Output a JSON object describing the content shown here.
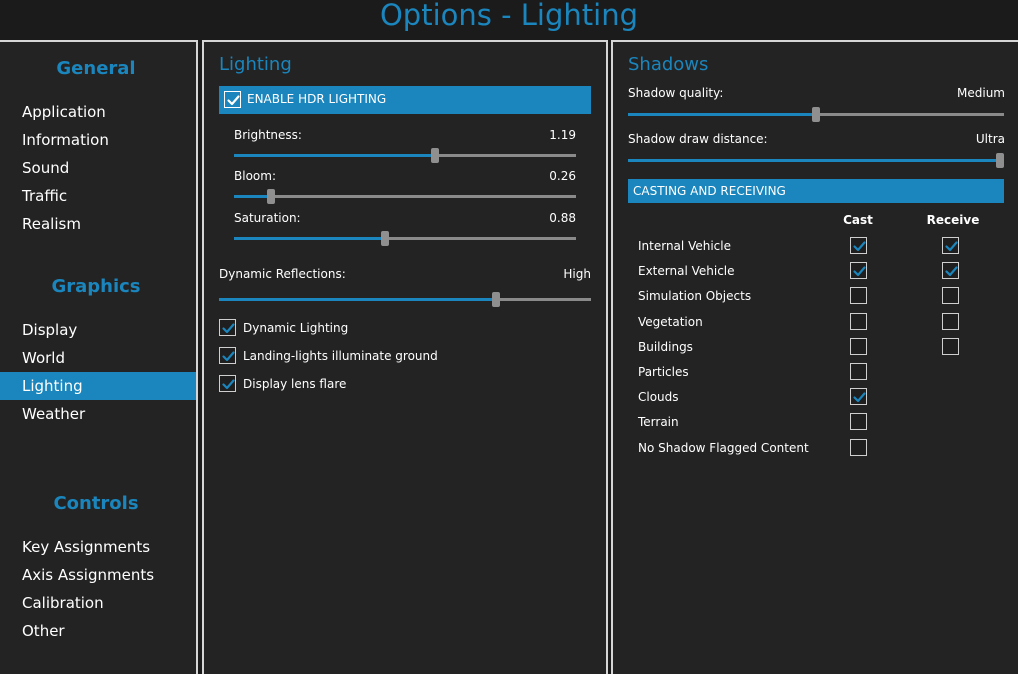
{
  "title": "Options - Lighting",
  "sidebar": {
    "sections": [
      {
        "heading": "General",
        "items": [
          "Application",
          "Information",
          "Sound",
          "Traffic",
          "Realism"
        ]
      },
      {
        "heading": "Graphics",
        "items": [
          "Display",
          "World",
          "Lighting",
          "Weather"
        ]
      },
      {
        "heading": "Controls",
        "items": [
          "Key Assignments",
          "Axis Assignments",
          "Calibration",
          "Other"
        ]
      }
    ],
    "active": "Lighting"
  },
  "lighting": {
    "heading": "Lighting",
    "hdr_label": "ENABLE HDR LIGHTING",
    "hdr_checked": true,
    "sliders": [
      {
        "label": "Brightness:",
        "value": "1.19",
        "fraction": 0.59
      },
      {
        "label": "Bloom:",
        "value": "0.26",
        "fraction": 0.1
      },
      {
        "label": "Saturation:",
        "value": "0.88",
        "fraction": 0.44
      }
    ],
    "reflections": {
      "label": "Dynamic Reflections:",
      "value": "High",
      "fraction": 0.75
    },
    "checks": [
      {
        "label": "Dynamic Lighting",
        "checked": true
      },
      {
        "label": "Landing-lights illuminate ground",
        "checked": true
      },
      {
        "label": "Display lens flare",
        "checked": true
      }
    ]
  },
  "shadows": {
    "heading": "Shadows",
    "quality": {
      "label": "Shadow quality:",
      "value": "Medium",
      "fraction": 0.5
    },
    "distance": {
      "label": "Shadow draw distance:",
      "value": "Ultra",
      "fraction": 1.0
    },
    "casting_header": "CASTING AND RECEIVING",
    "col_cast": "Cast",
    "col_receive": "Receive",
    "rows": [
      {
        "label": "Internal Vehicle",
        "cast": true,
        "receive": true
      },
      {
        "label": "External Vehicle",
        "cast": true,
        "receive": true
      },
      {
        "label": "Simulation Objects",
        "cast": false,
        "receive": false
      },
      {
        "label": "Vegetation",
        "cast": false,
        "receive": false
      },
      {
        "label": "Buildings",
        "cast": false,
        "receive": false
      },
      {
        "label": "Particles",
        "cast": false,
        "receive": null
      },
      {
        "label": "Clouds",
        "cast": true,
        "receive": null
      },
      {
        "label": "Terrain",
        "cast": false,
        "receive": null
      },
      {
        "label": "No Shadow Flagged Content",
        "cast": false,
        "receive": null
      }
    ]
  },
  "colors": {
    "accent": "#1a86bd",
    "panel": "#232323",
    "background": "#1b1b1b",
    "border": "#d6d6d6"
  }
}
